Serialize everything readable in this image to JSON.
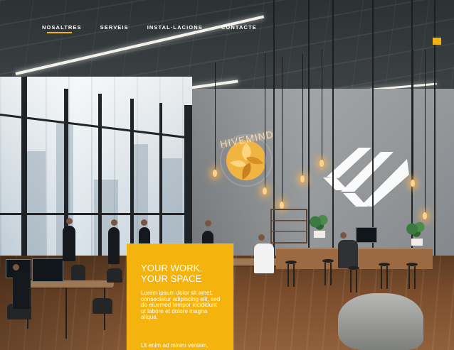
{
  "navigation": {
    "items": [
      {
        "label": "NOSALTRES"
      },
      {
        "label": "SERVEIS"
      },
      {
        "label": "INSTAL·LACIONS"
      },
      {
        "label": "CONTACTE"
      }
    ]
  },
  "hero": {
    "title_lines": [
      "YOUR WORK,",
      "YOUR SPACE"
    ],
    "paragraph_1": "Lorem ipsum dolor sit amet, consectetur adipiscing elit, sed do eiusmod tempor incididunt ut labore et dolore magna aliqua.",
    "paragraph_2": "Ut enim ad minim veniam,"
  },
  "background": {
    "brand_sign": "HIVEMIND"
  },
  "colors": {
    "accent": "#f4b30d",
    "nav_text": "#ffffff",
    "underline": "#f0b415"
  }
}
